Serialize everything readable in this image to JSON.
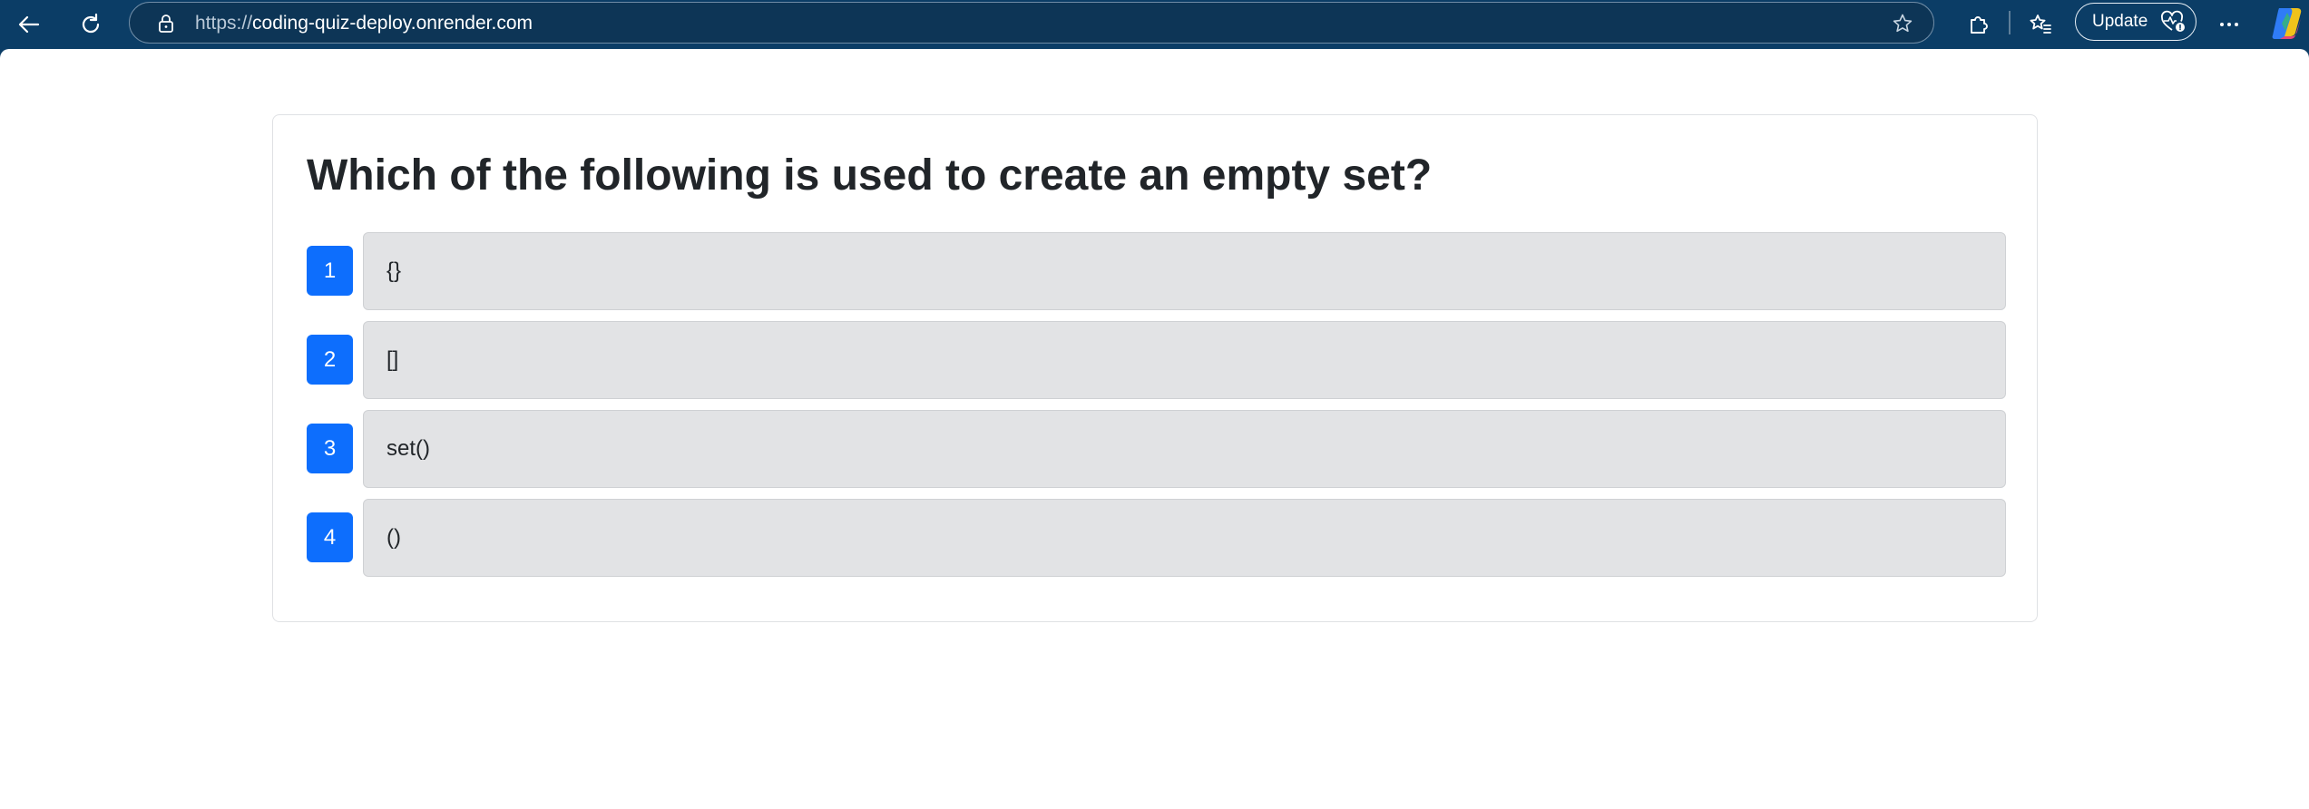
{
  "browser": {
    "url_protocol": "https://",
    "url_host": "coding-quiz-deploy.onrender.com",
    "update_label": "Update",
    "icons": {
      "back": "back-arrow-icon",
      "refresh": "refresh-icon",
      "lock": "lock-icon",
      "favorite": "star-icon",
      "extensions": "puzzle-icon",
      "favorites": "favorites-icon",
      "health": "heart-pulse-icon",
      "more": "more-icon",
      "copilot": "copilot-icon"
    },
    "colors": {
      "toolbar": "#0b3d66",
      "address_bar": "#0d3556"
    }
  },
  "quiz": {
    "question": "Which of the following is used to create an empty set?",
    "options": [
      {
        "number": "1",
        "text": "{}"
      },
      {
        "number": "2",
        "text": "[]"
      },
      {
        "number": "3",
        "text": "set()"
      },
      {
        "number": "4",
        "text": "()"
      }
    ],
    "colors": {
      "number_badge": "#0d6efd",
      "option_bg": "#e2e3e5",
      "text": "#212529"
    }
  }
}
